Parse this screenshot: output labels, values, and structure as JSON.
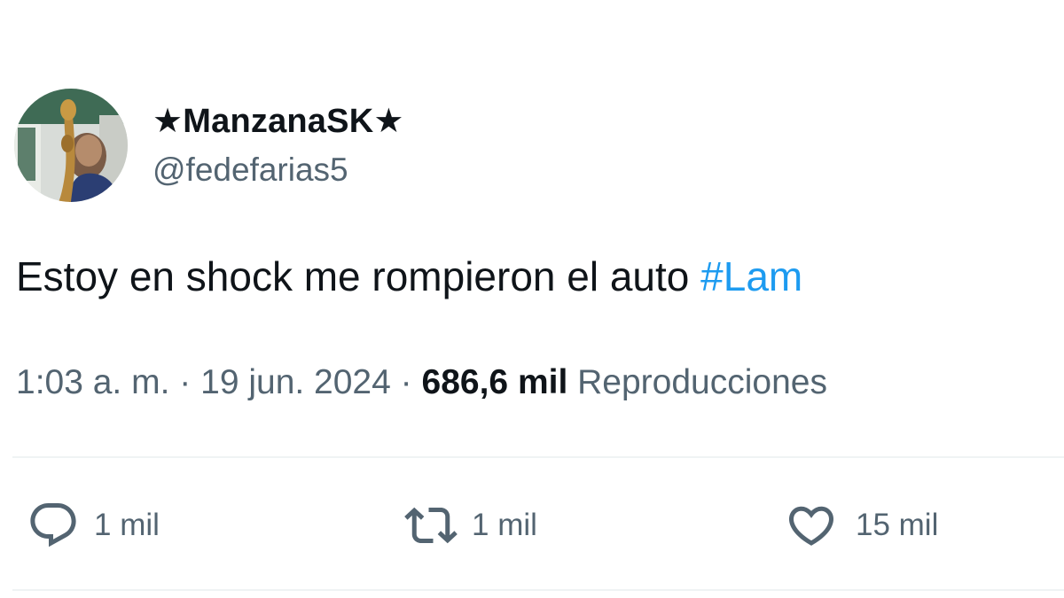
{
  "user": {
    "display_name": "★ManzanaSK★",
    "handle": "@fedefarias5"
  },
  "tweet": {
    "text": "Estoy en shock me rompieron el auto ",
    "hashtag": "#Lam"
  },
  "meta": {
    "time": "1:03 a. m.",
    "separator": "·",
    "date": "19 jun. 2024",
    "views_count": "686,6 mil",
    "views_label": "Reproducciones"
  },
  "actions": {
    "reply": {
      "icon": "reply-icon",
      "count": "1 mil"
    },
    "retweet": {
      "icon": "retweet-icon",
      "count": "1 mil"
    },
    "like": {
      "icon": "heart-icon",
      "count": "15 mil"
    }
  },
  "colors": {
    "text": "#0f1419",
    "secondary": "#536471",
    "link": "#1d9bf0",
    "divider": "#eff3f4"
  }
}
